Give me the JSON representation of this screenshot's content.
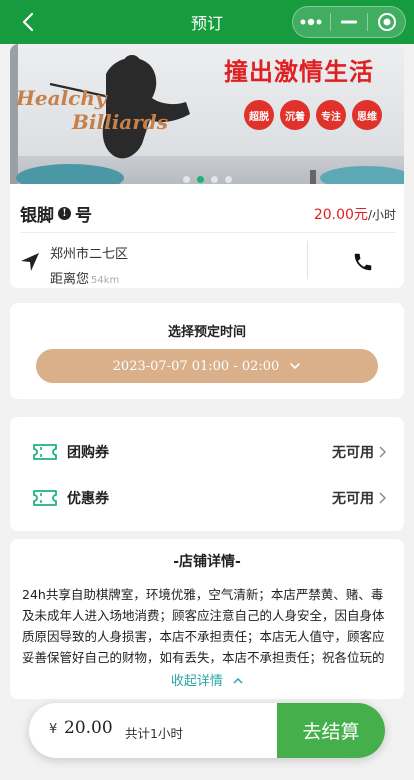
{
  "nav": {
    "title": "预订"
  },
  "banner": {
    "logo_line1": "Healchy",
    "logo_line2": "Billiards",
    "slogan": "撞出激情生活",
    "tags": [
      "超脱",
      "沉着",
      "专注",
      "思维"
    ],
    "active_slide": 2,
    "slide_count": 4
  },
  "shop": {
    "name_part1": "银脚",
    "info_mark": "!",
    "name_part2": "号",
    "price": "20.00元",
    "price_unit": "/小时",
    "address": "郑州市二七区",
    "distance_label": "距离您",
    "distance_value": "54km"
  },
  "booking": {
    "label": "选择预定时间",
    "time_range": "2023-07-07 01:00 - 02:00"
  },
  "coupons": [
    {
      "name": "团购券",
      "status": "无可用"
    },
    {
      "name": "优惠券",
      "status": "无可用"
    }
  ],
  "details": {
    "title": "-店铺详情-",
    "text": "24h共享自助棋牌室，环境优雅，空气清新；本店严禁黄、赌、毒及未成年人进入场地消费；顾客应注意自己的人身安全，因自身体质原因导致的人身损害，本店不承担责任；本店无人值守，顾客应妥善保管好自己的财物，如有丢失，本店不承担责任；祝各位玩的开心！！",
    "collapse_label": "收起详情"
  },
  "checkout": {
    "currency": "¥",
    "amount": "20.00",
    "summary": "共计1小时",
    "pay_label": "去结算"
  },
  "colors": {
    "brand_green": "#179b3f",
    "price_red": "#e02020",
    "time_pill": "#d9b08a",
    "coupon_teal": "#1bb37a",
    "pay_green": "#45b04b"
  }
}
